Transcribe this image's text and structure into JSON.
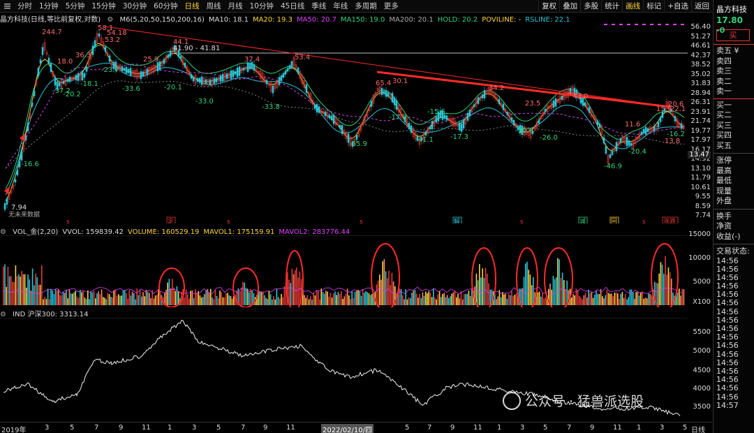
{
  "toolbar": {
    "timeframes": [
      "分时",
      "1分钟",
      "5分钟",
      "15分钟",
      "30分钟",
      "60分钟",
      "日线",
      "周线",
      "月线",
      "10分钟",
      "45日线",
      "季线",
      "年线",
      "多周期",
      "更多"
    ],
    "active_index": 6,
    "right_buttons": [
      "复权",
      "叠加",
      "多股",
      "统计",
      "画线",
      "标记",
      "+自选",
      "返回"
    ],
    "highlight_button_index": 4
  },
  "main": {
    "title": "晶方科技(日线,等比前复权,对数)",
    "indicators": [
      {
        "text": "M6(5,20,50,150,200,16)",
        "color": "#dddddd"
      },
      {
        "text": "MA10: 18.1",
        "color": "#dddddd"
      },
      {
        "text": "MA20: 19.3",
        "color": "#ffd43b"
      },
      {
        "text": "MA50: 20.7",
        "color": "#e040fb"
      },
      {
        "text": "MA150: 19.0",
        "color": "#31d37a"
      },
      {
        "text": "MA200: 20.1",
        "color": "#aaaaaa"
      },
      {
        "text": "HOLD: 20.2",
        "color": "#31d37a"
      },
      {
        "text": "POVILINE: -",
        "color": "#ffd43b"
      },
      {
        "text": "RSLINE: 22.1",
        "color": "#26c6da"
      }
    ],
    "price_ticks": [
      "56.40",
      "51.27",
      "46.61",
      "42.37",
      "38.52",
      "35.02",
      "31.83",
      "28.94",
      "26.31",
      "23.91",
      "21.74",
      "19.77",
      "17.97",
      "16.17",
      "14.92",
      "13.10",
      "11.79",
      "10.61",
      "9.55",
      "8.59",
      "7.74"
    ],
    "current_price_tag": "13.47",
    "annotations": {
      "peak_labels": [
        "244.7",
        "58.1",
        "54.18",
        "53.2",
        "36.3",
        "18.0",
        "25.9",
        "44.1",
        "41.90 - 41.81",
        "37.4",
        "53.4",
        "65.4",
        "30.1",
        "34.2",
        "43.0",
        "23.5",
        "20.6",
        "22.1",
        "15.9",
        "11.6",
        "13.8"
      ],
      "trough_labels": [
        "-37.2",
        "-20.2",
        "-18.1",
        "-23.7",
        "-33.6",
        "-20.1",
        "-33.0",
        "-33.8",
        "-55.9",
        "-17.9",
        "-41.1",
        "-17.3",
        "-15.6",
        "-30.6",
        "-26.0",
        "-46.9",
        "-20.4",
        "-16.2",
        "-16.6"
      ],
      "start_label": "7.94",
      "no_data_label": "无未来数据",
      "event_markers": [
        "定",
        "解",
        "减",
        "回",
        "涨跌"
      ]
    }
  },
  "volume": {
    "header": [
      {
        "text": "VOL_金(2,20)",
        "color": "#dddddd"
      },
      {
        "text": "VVOL: 159839.42",
        "color": "#dddddd"
      },
      {
        "text": "VOLUME: 160529.19",
        "color": "#ffd43b"
      },
      {
        "text": "MAVOL1: 175159.91",
        "color": "#ffd43b"
      },
      {
        "text": "MAVOL2: 283776.44",
        "color": "#e040fb"
      }
    ],
    "ticks": [
      "15000",
      "10000",
      "5000",
      "X100"
    ]
  },
  "index": {
    "header": "IND 沪深300: 3313.14",
    "ticks": [
      "5500",
      "5000",
      "4500",
      "4000",
      "3500"
    ]
  },
  "date_axis": {
    "labels": [
      "2019年",
      "3",
      "5",
      "7",
      "9",
      "11",
      "1",
      "3",
      "5",
      "7",
      "9",
      "11",
      "2022/02/10/四",
      "5",
      "7",
      "9",
      "11",
      "1",
      "3",
      "5",
      "7",
      "9",
      "11",
      "1",
      "3",
      "5",
      "7"
    ],
    "right_label": "日线"
  },
  "sidebar": {
    "title": "晶方科技",
    "price": "17.80",
    "price_suffix": "-0",
    "buy_label": "买",
    "sell_levels": [
      "卖五 ¥",
      "卖四",
      "卖三",
      "卖二",
      "卖一"
    ],
    "buy_levels": [
      "买一",
      "买二",
      "买三",
      "买四",
      "买五"
    ],
    "stats": [
      "涨停",
      "最高",
      "最低",
      "现量",
      "外盘"
    ],
    "stats2": [
      "换手",
      "净资",
      "收益(-)"
    ],
    "trade_state": "交易状态:",
    "times": [
      "14:56",
      "14:56",
      "14:56",
      "14:56",
      "14:56",
      "14:56",
      "14:56",
      "14:56",
      "14:56",
      "14:56",
      "14:56",
      "14:56",
      "14:56",
      "14:56",
      "14:56",
      "14:56",
      "14:56",
      "14:57"
    ]
  },
  "watermark": {
    "text": "公众号 · 猛兽派选股"
  },
  "colors": {
    "up": "#e53935",
    "down": "#26c6da",
    "trend_line": "#ff2a2a",
    "circle": "#ff2a2a",
    "hline": "#bbbbbb"
  }
}
